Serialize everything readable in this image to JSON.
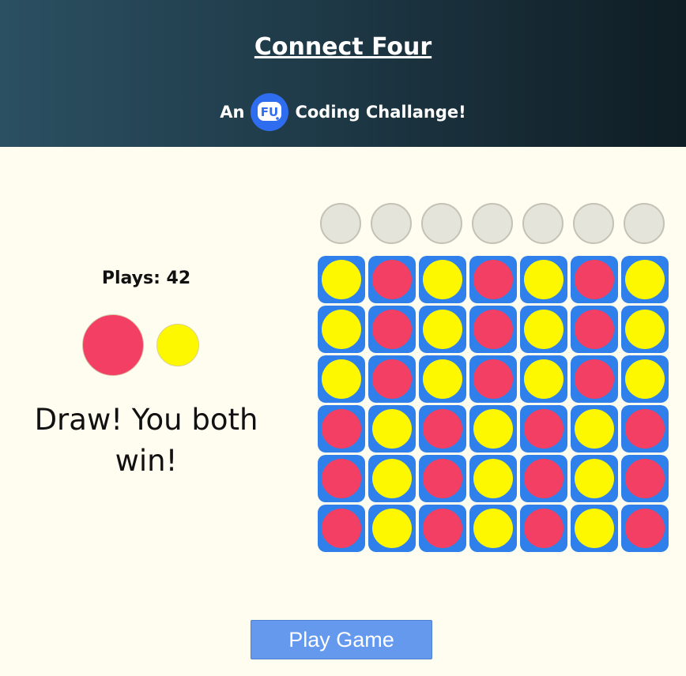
{
  "header": {
    "title": "Connect Four",
    "subtitle_prefix": "An",
    "logo_icon": "fu-logo-icon",
    "subtitle_suffix": "Coding Challange!"
  },
  "status": {
    "plays_label": "Plays: 42",
    "message": "Draw! You both win!",
    "player_colors": [
      "#f23f63",
      "#fdf700"
    ]
  },
  "colors": {
    "red": "#f23f63",
    "yellow": "#fdf700",
    "cell": "#2f80ea",
    "slot": "#e5e4db",
    "header_start": "#2b5062",
    "header_end": "#0f1d24",
    "background": "#fffdf0",
    "button": "#6499ee"
  },
  "board": {
    "columns": 7,
    "rows": 6,
    "grid": [
      [
        "Y",
        "R",
        "Y",
        "R",
        "Y",
        "R",
        "Y"
      ],
      [
        "Y",
        "R",
        "Y",
        "R",
        "Y",
        "R",
        "Y"
      ],
      [
        "Y",
        "R",
        "Y",
        "R",
        "Y",
        "R",
        "Y"
      ],
      [
        "R",
        "Y",
        "R",
        "Y",
        "R",
        "Y",
        "R"
      ],
      [
        "R",
        "Y",
        "R",
        "Y",
        "R",
        "Y",
        "R"
      ],
      [
        "R",
        "Y",
        "R",
        "Y",
        "R",
        "Y",
        "R"
      ]
    ]
  },
  "controls": {
    "play_button_label": "Play Game"
  }
}
